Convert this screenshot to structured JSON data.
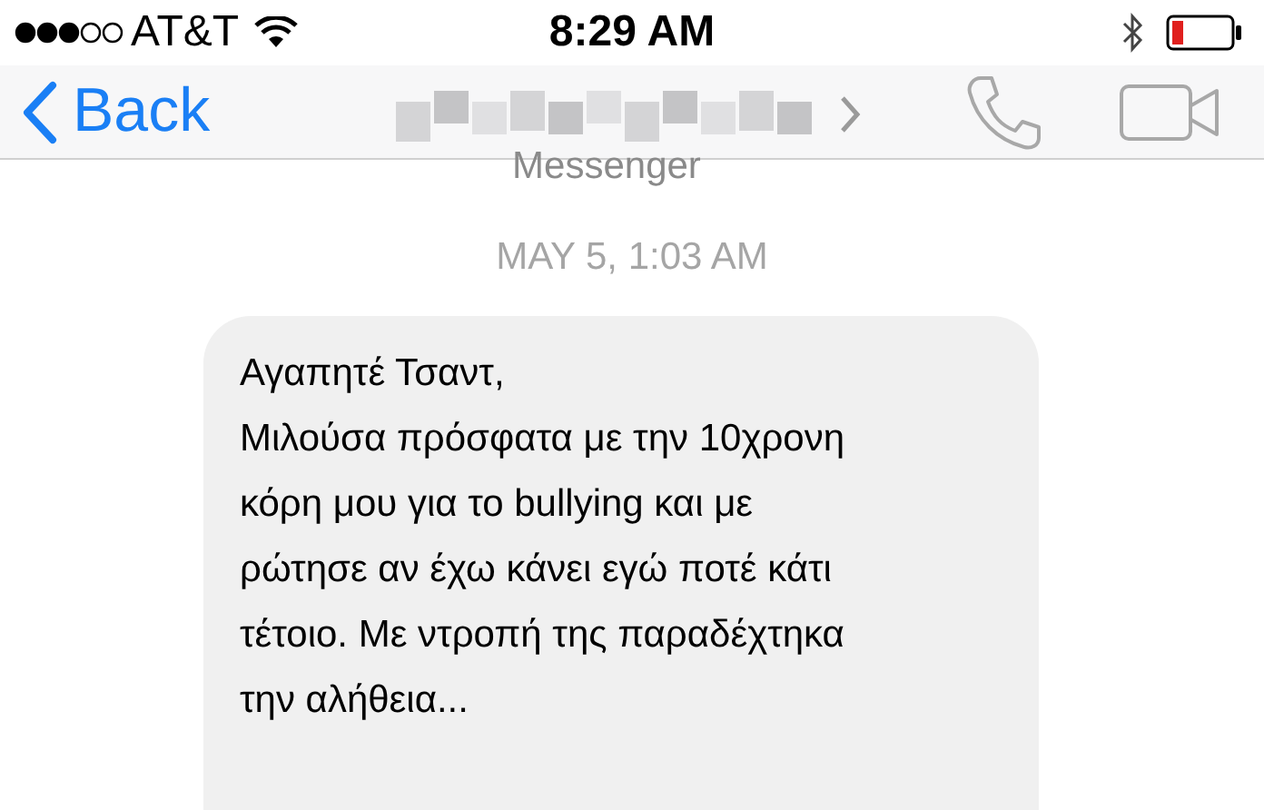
{
  "status_bar": {
    "carrier": "AT&T",
    "time": "8:29 AM"
  },
  "nav": {
    "back": "Back",
    "subtitle": "Messenger"
  },
  "thread": {
    "timestamp": "MAY 5, 1:03 AM",
    "messages": [
      {
        "text": "Αγαπητέ Τσαντ,\nΜιλούσα πρόσφατα με την 10χρονη\nκόρη μου για το bullying και με\nρώτησε αν έχω κάνει εγώ ποτέ κάτι\nτέτοιο. Με ντροπή της παραδέχτηκα\nτην αλήθεια..."
      }
    ]
  }
}
